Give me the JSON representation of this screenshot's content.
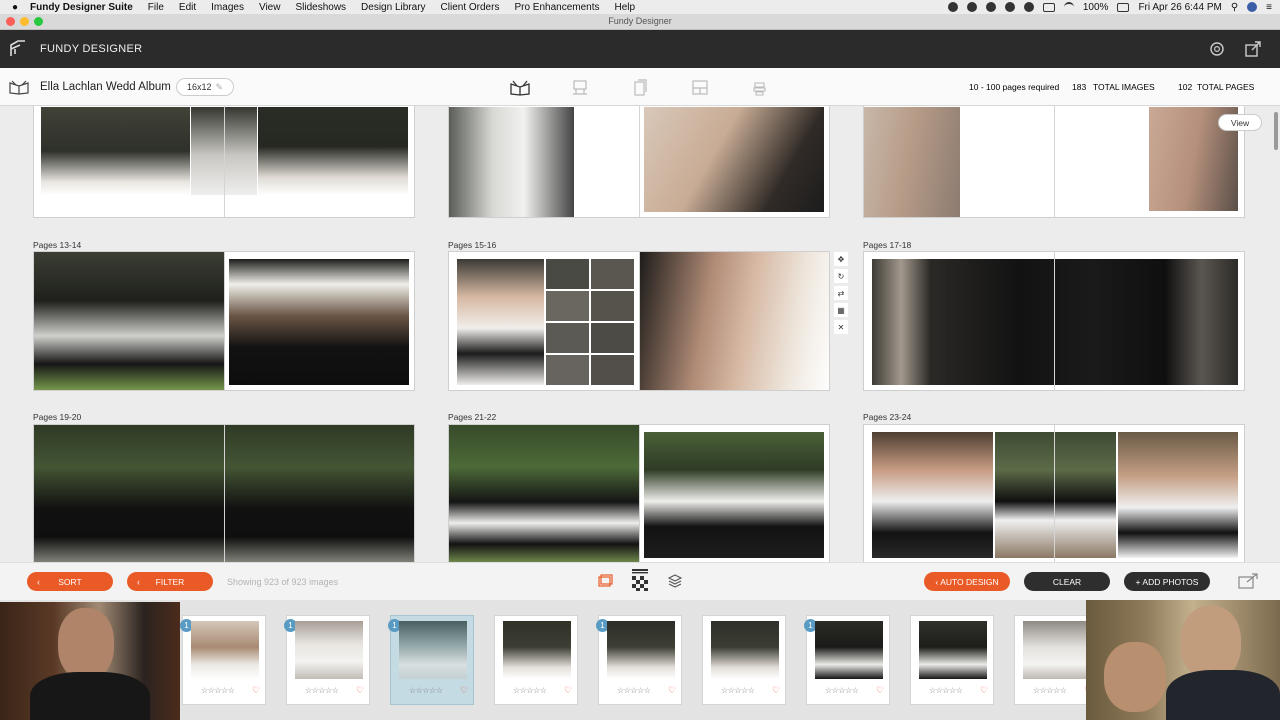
{
  "menubar": {
    "app": "Fundy Designer Suite",
    "items": [
      "File",
      "Edit",
      "Images",
      "View",
      "Slideshows",
      "Design Library",
      "Client Orders",
      "Pro Enhancements",
      "Help"
    ],
    "battery": "100%",
    "datetime": "Fri Apr 26  6:44 PM"
  },
  "window": {
    "title": "Fundy Designer"
  },
  "header": {
    "app_name": "FUNDY DESIGNER"
  },
  "album": {
    "name": "Ella Lachlan Wedd Album",
    "size": "16x12",
    "pages_required": "10 - 100 pages required",
    "total_images_count": "183",
    "total_images_label": "TOTAL IMAGES",
    "total_pages_count": "102",
    "total_pages_label": "TOTAL PAGES"
  },
  "spreads": {
    "view_button": "View",
    "labels": [
      "Pages 13-14",
      "Pages 15-16",
      "Pages 17-18",
      "Pages 19-20",
      "Pages 21-22",
      "Pages 23-24"
    ]
  },
  "actionbar": {
    "sort": "SORT",
    "filter": "FILTER",
    "showing": "Showing 923 of 923 images",
    "auto_design": "AUTO DESIGN",
    "clear": "CLEAR",
    "add_photos": "+ ADD PHOTOS"
  },
  "filmstrip": {
    "badge": "1",
    "stars": "☆☆☆☆☆",
    "heart": "♡"
  },
  "colors": {
    "accent": "#ea5a27",
    "dark": "#2b2b2b",
    "badge": "#5a9bc4"
  }
}
